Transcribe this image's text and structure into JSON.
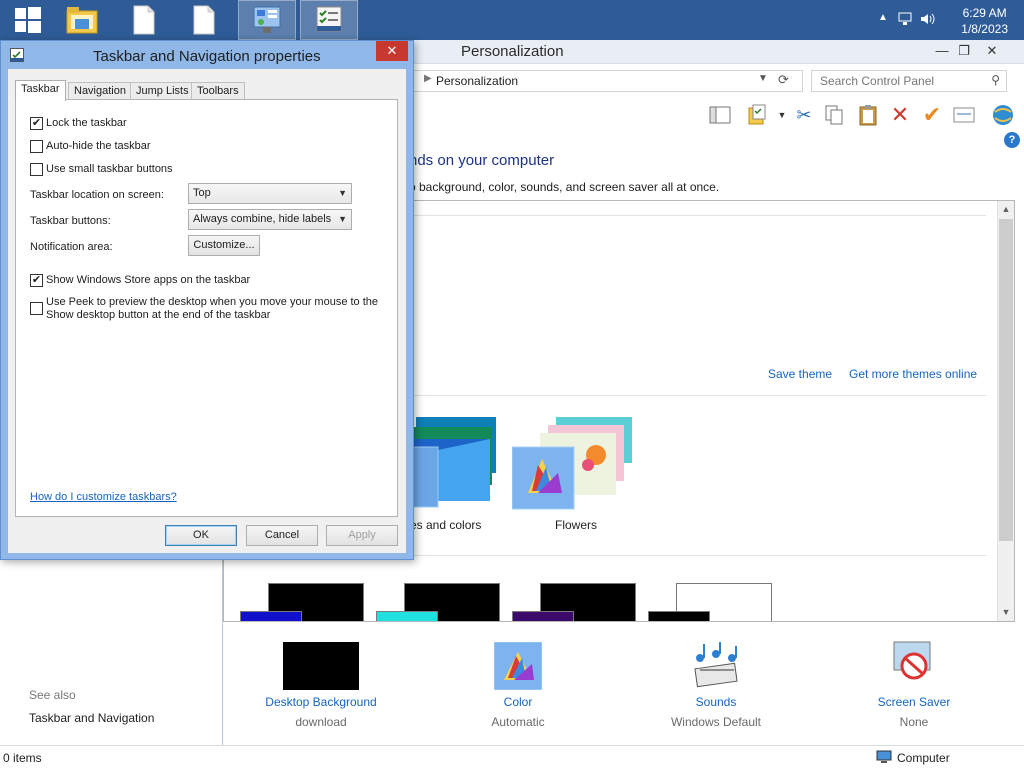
{
  "taskbar": {
    "tray_time": "6:29 AM",
    "tray_date": "1/8/2023"
  },
  "cp": {
    "title": "Personalization",
    "address": "Personalization",
    "search_placeholder": "Search Control Panel",
    "heading": "nds on your computer",
    "subheading": "o background, color, sounds, and screen saver all at once.",
    "save_theme": "Save theme",
    "get_more_themes": "Get more themes online",
    "theme_labels": [
      "es and colors",
      "Flowers"
    ],
    "bottom_items": [
      {
        "name": "Desktop Background",
        "value": "download"
      },
      {
        "name": "Color",
        "value": "Automatic"
      },
      {
        "name": "Sounds",
        "value": "Windows Default"
      },
      {
        "name": "Screen Saver",
        "value": "None"
      }
    ],
    "see_also": "See also",
    "see_also_link": "Taskbar and Navigation",
    "status_items": "0 items",
    "status_computer": "Computer"
  },
  "dialog": {
    "title": "Taskbar and Navigation properties",
    "close_glyph": "✕",
    "tabs": [
      "Taskbar",
      "Navigation",
      "Jump Lists",
      "Toolbars"
    ],
    "checkboxes": {
      "lock": {
        "label": "Lock the taskbar",
        "checked": true
      },
      "autohide": {
        "label": "Auto-hide the taskbar",
        "checked": false
      },
      "small": {
        "label": "Use small taskbar buttons",
        "checked": false
      },
      "store": {
        "label": "Show Windows Store apps on the taskbar",
        "checked": true
      },
      "peek_line1": "Use Peek to preview the desktop when you move your mouse to the",
      "peek_line2": "Show desktop button at the end of the taskbar"
    },
    "location_label": "Taskbar location on screen:",
    "location_value": "Top",
    "buttons_label": "Taskbar buttons:",
    "buttons_value": "Always combine, hide labels",
    "notification_label": "Notification area:",
    "customize": "Customize...",
    "help_link": "How do I customize taskbars?",
    "ok": "OK",
    "cancel": "Cancel",
    "apply": "Apply"
  },
  "colors": {
    "taskbar": "#2f5c97",
    "link": "#1565c0",
    "dialog_frame": "#8fb8e8",
    "close_red": "#c7392f"
  }
}
